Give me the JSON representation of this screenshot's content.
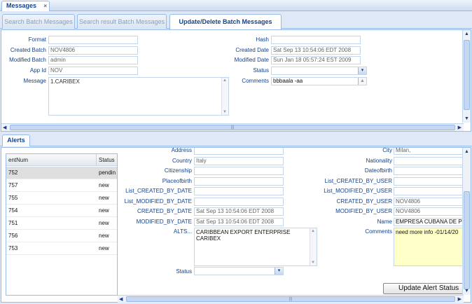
{
  "window": {
    "title": "Messages",
    "close_icon": "×"
  },
  "tabs": [
    {
      "label": "Search Batch Messages"
    },
    {
      "label": "Search result Batch Messages"
    },
    {
      "label": "Update/Delete Batch Messages"
    }
  ],
  "batch_form": {
    "format": {
      "label": "Format",
      "value": ""
    },
    "created_batch": {
      "label": "Created Batch",
      "value": "NOV4806"
    },
    "modified_batch": {
      "label": "Modified Batch",
      "value": "admin"
    },
    "app_id": {
      "label": "App Id",
      "value": "NOV"
    },
    "message": {
      "label": "Message",
      "value": "1.CARIBEX"
    },
    "hash": {
      "label": "Hash",
      "value": ""
    },
    "created_date": {
      "label": "Created Date",
      "value": "Sat Sep 13 10:54:06 EDT 2008"
    },
    "modified_date": {
      "label": "Modified Date",
      "value": "Sun Jan 18 05:57:24 EST 2009"
    },
    "status": {
      "label": "Status",
      "value": ""
    },
    "comments": {
      "label": "Comments",
      "value": "bbbaala -aa"
    }
  },
  "alerts_tab": {
    "label": "Alerts"
  },
  "alerts_grid": {
    "columns": [
      "entNum",
      "Status"
    ],
    "rows": [
      [
        "752",
        "pendin"
      ],
      [
        "757",
        "new"
      ],
      [
        "755",
        "new"
      ],
      [
        "754",
        "new"
      ],
      [
        "751",
        "new"
      ],
      [
        "756",
        "new"
      ],
      [
        "753",
        "new"
      ]
    ]
  },
  "alert_form": {
    "address": {
      "label": "Address",
      "value": ""
    },
    "city": {
      "label": "City",
      "value": "Milan,"
    },
    "country": {
      "label": "Country",
      "value": "Italy"
    },
    "nationality": {
      "label": "Nationality",
      "value": ""
    },
    "citizenship": {
      "label": "Citizenship",
      "value": ""
    },
    "dateofbirth": {
      "label": "Dateofbirth",
      "value": ""
    },
    "placeofbirth": {
      "label": "Placeofbirth",
      "value": ""
    },
    "list_created_by_user": {
      "label": "List_CREATED_BY_USER",
      "value": ""
    },
    "list_created_by_date": {
      "label": "List_CREATED_BY_DATE",
      "value": ""
    },
    "list_modified_by_user": {
      "label": "List_MODIFIED_BY_USER",
      "value": ""
    },
    "list_modified_by_date": {
      "label": "List_MODIFIED_BY_DATE",
      "value": ""
    },
    "created_by_user": {
      "label": "CREATED_BY_USER",
      "value": "NOV4806"
    },
    "created_by_date": {
      "label": "CREATED_BY_DATE",
      "value": "Sat Sep 13 10:54:06 EDT 2008"
    },
    "modified_by_user": {
      "label": "MODIFIED_BY_USER",
      "value": "NOV4806"
    },
    "modified_by_date": {
      "label": "MODIFIED_BY_DATE",
      "value": "Sat Sep 13 10:54:06 EDT 2008"
    },
    "name": {
      "label": "Name",
      "value": "EMPRESA CUBANA DE PES"
    },
    "alts": {
      "label": "ALTS...",
      "value_line1": "CARIBBEAN EXPORT ENTERPRISE",
      "value_line2": "CARIBEX"
    },
    "comments": {
      "label": "Comments",
      "value": "need more info -01/14/20"
    },
    "status": {
      "label": "Status",
      "value": ""
    }
  },
  "update_alert_button": {
    "label": "Update Alert Status"
  },
  "icons": {
    "dropdown": "▾",
    "scroll_up": "▲",
    "scroll_down": "▼",
    "scroll_left": "◀",
    "scroll_right": "▶",
    "grip": "|||"
  },
  "colors": {
    "accent": "#15428b",
    "border": "#99bbe8",
    "comments_bg": "#ffffc8"
  }
}
